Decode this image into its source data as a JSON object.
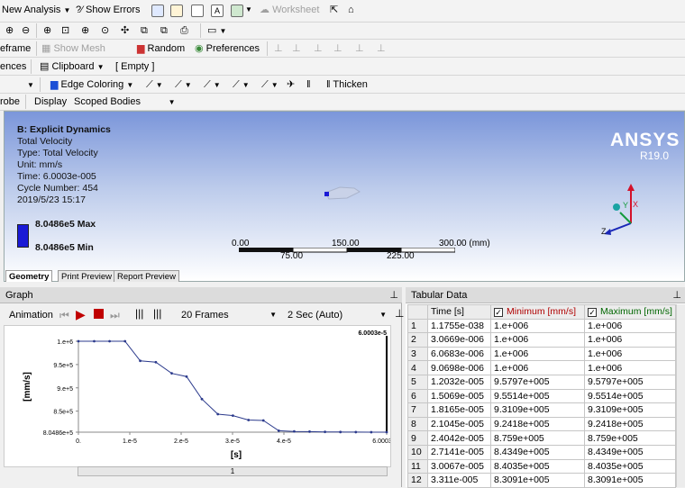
{
  "toolbar1": {
    "new_analysis": "New Analysis",
    "show_errors": "?⁄ Show Errors",
    "worksheet": "Worksheet"
  },
  "toolbar2": {
    "wireframe": "eframe",
    "show_mesh": "Show Mesh",
    "random": "Random",
    "preferences": "Preferences"
  },
  "toolbar3": {
    "ences": "ences",
    "clipboard": "Clipboard",
    "empty": "[ Empty ]"
  },
  "toolbar4": {
    "edge_coloring": "Edge Coloring",
    "thicken": "Thicken"
  },
  "toolbar5": {
    "probe": "robe",
    "display": "Display",
    "scoped_bodies": "Scoped Bodies"
  },
  "viewport": {
    "title": "B: Explicit Dynamics",
    "line1": "Total Velocity",
    "line2": "Type: Total Velocity",
    "line3": "Unit: mm/s",
    "line4": "Time: 6.0003e-005",
    "line5": "Cycle Number: 454",
    "line6": "2019/5/23 15:17",
    "legend_max": "8.0486e5 Max",
    "legend_min": "8.0486e5 Min",
    "legend_color": "#1a1ad6",
    "brand": "ANSYS",
    "version": "R19.0",
    "scale_0": "0.00",
    "scale_150": "150.00",
    "scale_300": "300.00 (mm)",
    "scale_75": "75.00",
    "scale_225": "225.00",
    "axis_x": "X",
    "axis_y": "Y",
    "axis_z": "Z"
  },
  "view_tabs": [
    "Geometry",
    "Print Preview",
    "Report Preview"
  ],
  "graph": {
    "header": "Graph",
    "animation": "Animation",
    "frames": "20 Frames",
    "duration": "2 Sec (Auto)",
    "slider_value": "1"
  },
  "tabular": {
    "header": "Tabular Data",
    "columns": [
      "Time [s]",
      "Minimum [mm/s]",
      "Maximum [mm/s]"
    ],
    "rows": [
      [
        "1",
        "1.1755e-038",
        "1.e+006",
        "1.e+006"
      ],
      [
        "2",
        "3.0669e-006",
        "1.e+006",
        "1.e+006"
      ],
      [
        "3",
        "6.0683e-006",
        "1.e+006",
        "1.e+006"
      ],
      [
        "4",
        "9.0698e-006",
        "1.e+006",
        "1.e+006"
      ],
      [
        "5",
        "1.2032e-005",
        "9.5797e+005",
        "9.5797e+005"
      ],
      [
        "6",
        "1.5069e-005",
        "9.5514e+005",
        "9.5514e+005"
      ],
      [
        "7",
        "1.8165e-005",
        "9.3109e+005",
        "9.3109e+005"
      ],
      [
        "8",
        "2.1045e-005",
        "9.2418e+005",
        "9.2418e+005"
      ],
      [
        "9",
        "2.4042e-005",
        "8.759e+005",
        "8.759e+005"
      ],
      [
        "10",
        "2.7141e-005",
        "8.4349e+005",
        "8.4349e+005"
      ],
      [
        "11",
        "3.0067e-005",
        "8.4035e+005",
        "8.4035e+005"
      ],
      [
        "12",
        "3.311e-005",
        "8.3091e+005",
        "8.3091e+005"
      ]
    ],
    "min_color": "#b00000",
    "max_color": "#006600"
  },
  "chart_data": {
    "type": "line",
    "xlabel": "[s]",
    "ylabel": "[mm/s]",
    "xlim": [
      0,
      6.0003e-05
    ],
    "ylim": [
      804860,
      1000000
    ],
    "x_ticks": [
      "0.",
      "1.e-5",
      "2.e-5",
      "3.e-5",
      "4.e-5",
      "6.0003e-5"
    ],
    "y_ticks": [
      "8.0486e+5",
      "8.5e+5",
      "9.e+5",
      "9.5e+5",
      "1.e+6"
    ],
    "current_time_label": "6.0003e-5",
    "series_color": "#2b3a8c",
    "x": [
      0,
      3.0669e-06,
      6.0683e-06,
      9.0698e-06,
      1.2032e-05,
      1.5069e-05,
      1.8165e-05,
      2.1045e-05,
      2.4042e-05,
      2.7141e-05,
      3.0067e-05,
      3.311e-05,
      3.6e-05,
      3.9e-05,
      4.2e-05,
      4.5e-05,
      4.8e-05,
      5.1e-05,
      5.4e-05,
      5.7e-05,
      6.0003e-05
    ],
    "y": [
      1000000,
      1000000,
      1000000,
      1000000,
      957970,
      955140,
      931090,
      924180,
      875900,
      843490,
      840350,
      830910,
      830000,
      808000,
      806500,
      806000,
      805500,
      805200,
      805000,
      804900,
      804860
    ]
  }
}
